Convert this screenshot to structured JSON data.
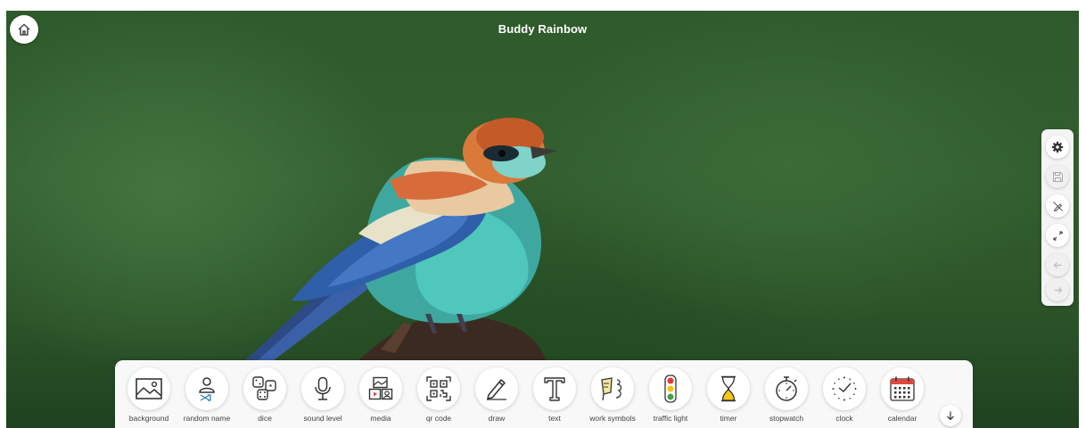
{
  "app": {
    "title": "Buddy Rainbow"
  },
  "home": {
    "icon": "home-icon"
  },
  "background_image": {
    "subject": "bird-on-branch-photo"
  },
  "side_panel": {
    "buttons": [
      {
        "icon": "gear-icon",
        "enabled": true
      },
      {
        "icon": "save-icon",
        "enabled": false
      },
      {
        "icon": "no-pen-icon",
        "enabled": true
      },
      {
        "icon": "fullscreen-icon",
        "enabled": true
      },
      {
        "icon": "arrow-left-icon",
        "enabled": false
      },
      {
        "icon": "arrow-right-icon",
        "enabled": false
      }
    ]
  },
  "toolbar": {
    "tools": [
      {
        "label": "background",
        "icon": "image-icon"
      },
      {
        "label": "random name",
        "icon": "person-shuffle-icon"
      },
      {
        "label": "dice",
        "icon": "dice-icon"
      },
      {
        "label": "sound level",
        "icon": "microphone-icon"
      },
      {
        "label": "media",
        "icon": "media-icon"
      },
      {
        "label": "qr code",
        "icon": "qr-code-icon"
      },
      {
        "label": "draw",
        "icon": "pencil-icon"
      },
      {
        "label": "text",
        "icon": "text-icon"
      },
      {
        "label": "work symbols",
        "icon": "work-symbols-icon"
      },
      {
        "label": "traffic light",
        "icon": "traffic-light-icon"
      },
      {
        "label": "timer",
        "icon": "hourglass-icon"
      },
      {
        "label": "stopwatch",
        "icon": "stopwatch-icon"
      },
      {
        "label": "clock",
        "icon": "clock-icon"
      },
      {
        "label": "calendar",
        "icon": "calendar-icon"
      }
    ],
    "collapse_icon": "arrow-down-icon"
  },
  "colors": {
    "background_green": "#2f5a2b",
    "calendar_red": "#e0473d",
    "traffic_red": "#e53935",
    "traffic_yellow": "#f4c20d",
    "traffic_green": "#43a047",
    "hourglass_yellow": "#f5c518"
  }
}
